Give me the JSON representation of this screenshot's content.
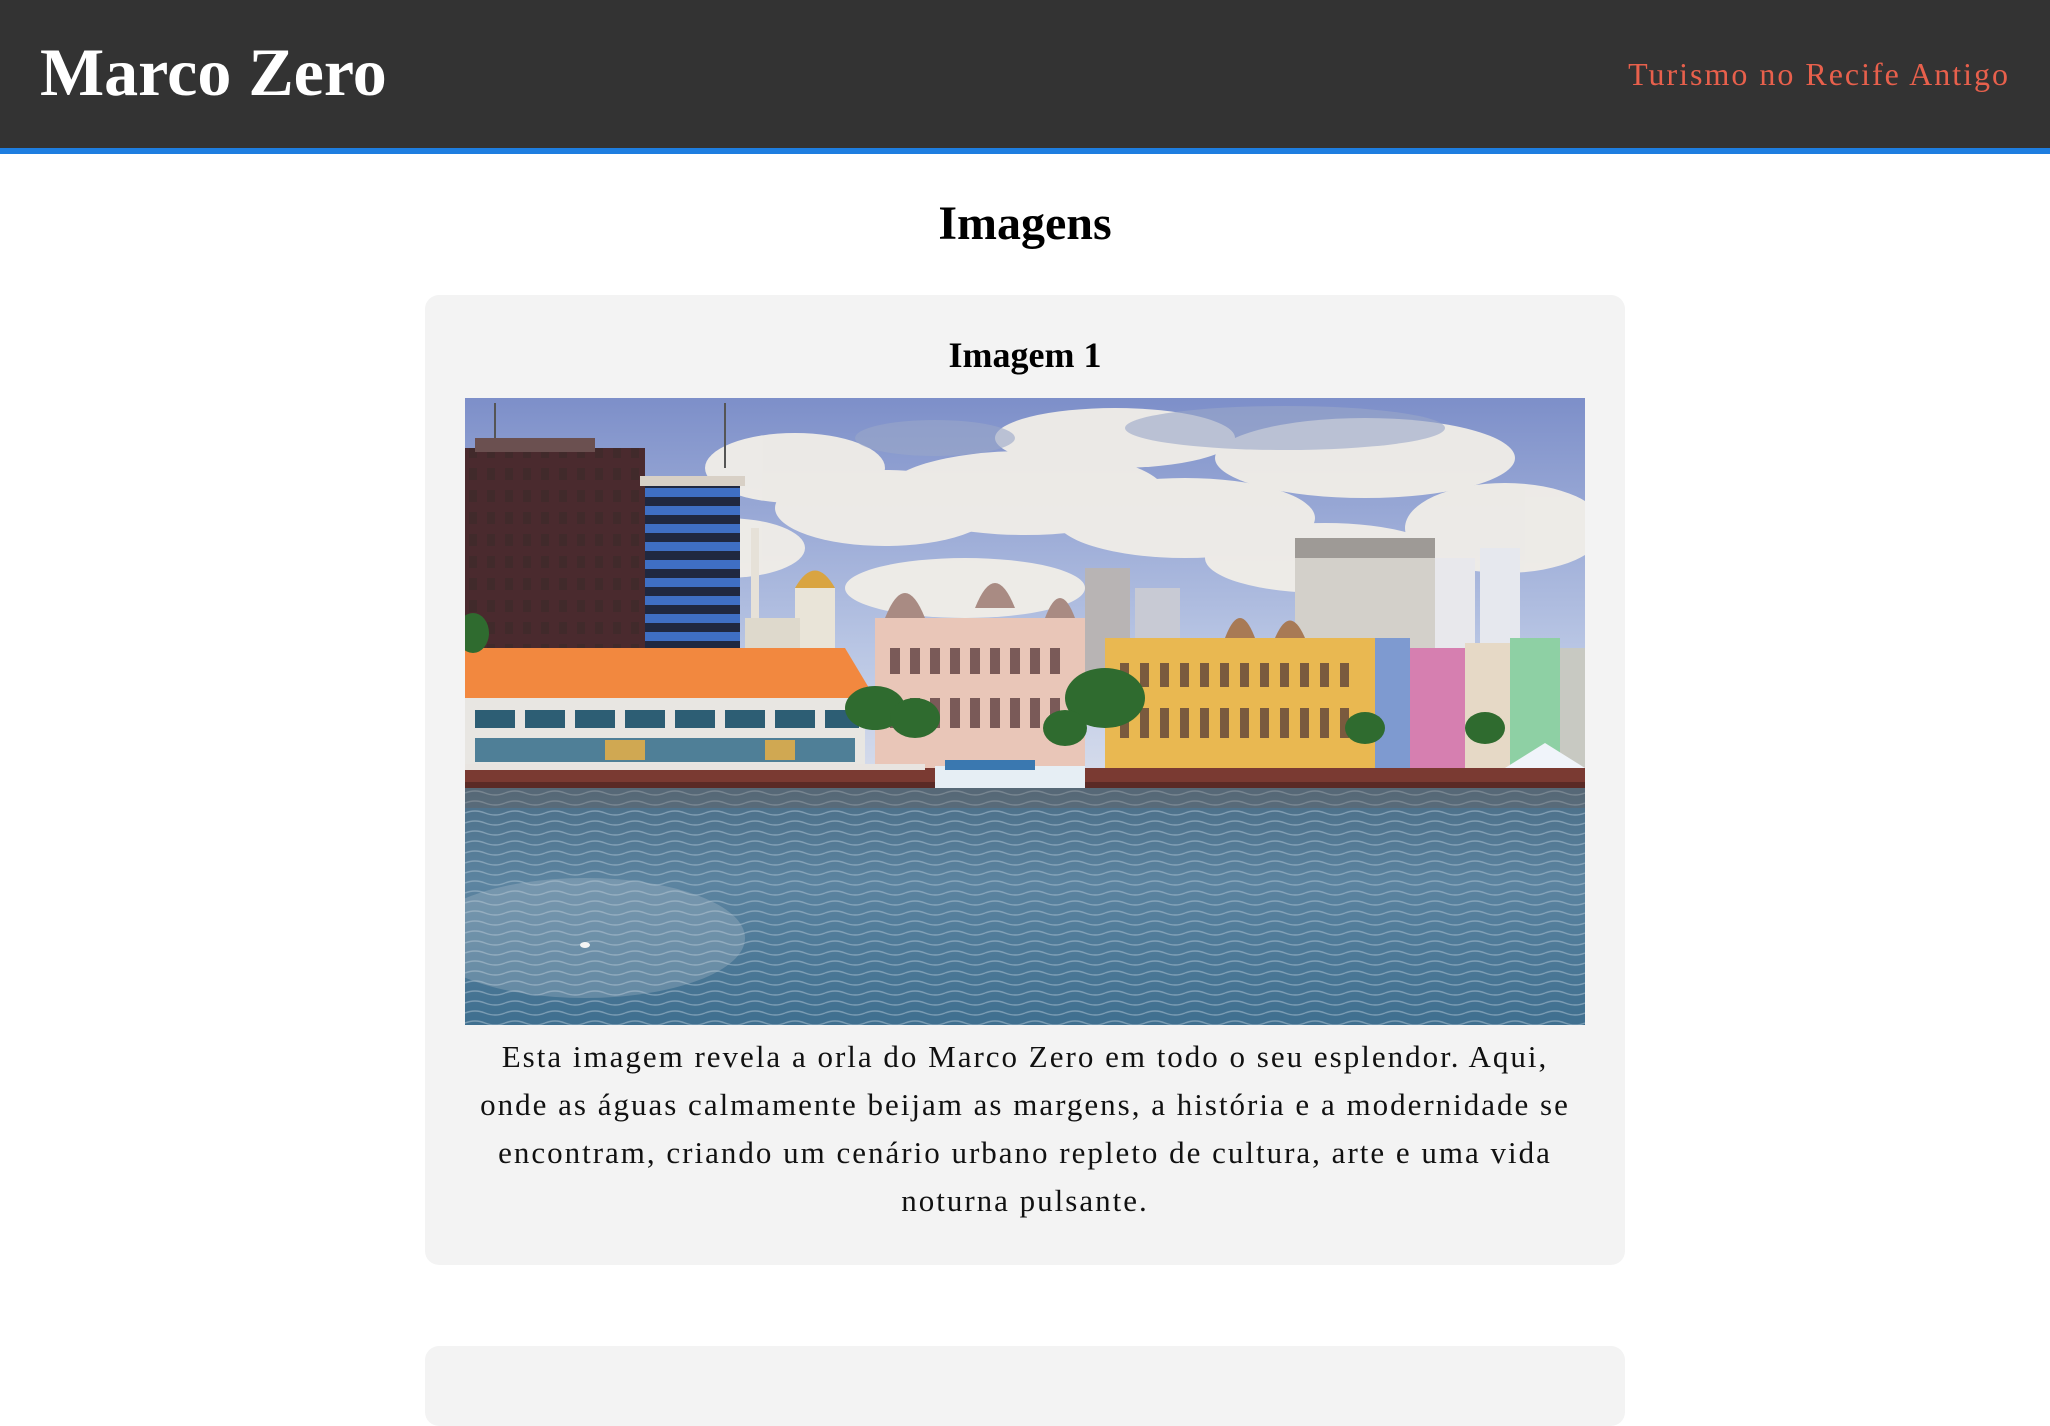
{
  "header": {
    "brand": "Marco Zero",
    "nav_link": "Turismo no Recife Antigo",
    "background_color": "#333333",
    "accent_border_color": "#1e7ee0",
    "link_color": "#e8604c"
  },
  "main": {
    "section_title": "Imagens",
    "cards": [
      {
        "title": "Imagem 1",
        "image_subject": "Recife Antigo waterfront with colorful historic buildings, modern towers and river",
        "caption": "Esta imagem revela a orla do Marco Zero em todo o seu esplendor. Aqui, onde as águas calmamente beijam as margens, a história e a modernidade se encontram, criando um cenário urbano repleto de cultura, arte e uma vida noturna pulsante."
      }
    ]
  }
}
